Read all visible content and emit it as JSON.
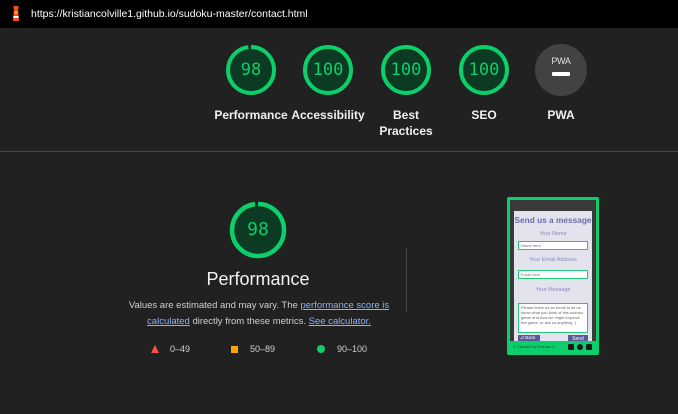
{
  "browser": {
    "url": "https://kristiancolville1.github.io/sudoku-master/contact.html",
    "icon": "lighthouse-icon"
  },
  "summary": {
    "gauges": [
      {
        "label": "Performance",
        "score": "98"
      },
      {
        "label": "Accessibility",
        "score": "100"
      },
      {
        "label": "Best Practices",
        "score": "100"
      },
      {
        "label": "SEO",
        "score": "100"
      }
    ],
    "pwa": {
      "label": "PWA",
      "badge": "PWA"
    }
  },
  "performance": {
    "score": "98",
    "title": "Performance",
    "desc_prefix": "Values are estimated and may vary. The ",
    "link_score": "performance score is calculated",
    "desc_middle": " directly from these metrics. ",
    "link_calc": "See calculator."
  },
  "legend": [
    {
      "range": "0–49",
      "color": "#ff4e42",
      "shape": "triangle"
    },
    {
      "range": "50–89",
      "color": "#ffa400",
      "shape": "square"
    },
    {
      "range": "90–100",
      "color": "#0cce6b",
      "shape": "circle"
    }
  ],
  "thumbnail": {
    "title": "Send us a message",
    "name_label": "Your Name",
    "name_placeholder": "Name here",
    "email_label": "Your Email Address",
    "email_placeholder": "Email here",
    "message_label": "Your Message",
    "message_text": "Please leave us an email to let us know what you think of this sudoku game and how we might improve the game, or ask us anything :)",
    "back_button": "⮐ Back",
    "send_button": "Send",
    "footer_text": "© Created by Kristian C."
  },
  "colors": {
    "pass": "#0cce6b",
    "average": "#ffa400",
    "fail": "#ff4e42",
    "link": "#8ab4f8",
    "background": "#212121"
  }
}
